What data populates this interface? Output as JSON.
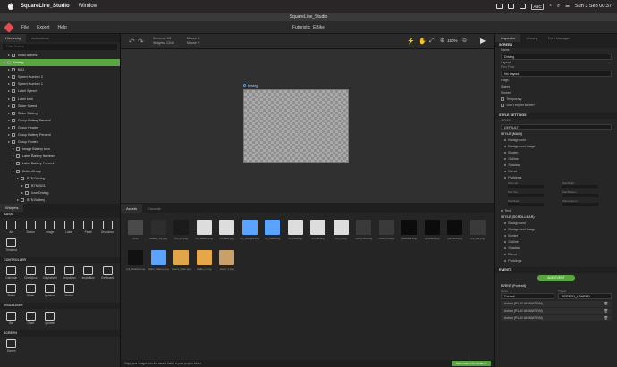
{
  "menubar": {
    "app_name": "SquareLine_Studio",
    "window_menu": "Window",
    "abc": "ABC",
    "datetime": "Sun 3 Sep  00:37"
  },
  "window": {
    "title": "SquareLine_Studio"
  },
  "appbar": {
    "menus": [
      "File",
      "Export",
      "Help"
    ],
    "project_title": "Futuristic_EBike"
  },
  "hierarchy": {
    "tabs": [
      "Hierarchy",
      "Animations"
    ],
    "search_placeholder": "Filter Screen",
    "rows": [
      {
        "label": "Initial actions",
        "indent": 1,
        "selected": false
      },
      {
        "label": "Driving",
        "indent": 0,
        "selected": true
      },
      {
        "label": "BG1",
        "indent": 1,
        "selected": false
      },
      {
        "label": "Speed Number 2",
        "indent": 1,
        "selected": false
      },
      {
        "label": "Speed Number 1",
        "indent": 1,
        "selected": false
      },
      {
        "label": "Label Speed",
        "indent": 1,
        "selected": false
      },
      {
        "label": "Label kmh",
        "indent": 1,
        "selected": false
      },
      {
        "label": "Slider Speed",
        "indent": 1,
        "selected": false
      },
      {
        "label": "Slider Battery",
        "indent": 1,
        "selected": false
      },
      {
        "label": "Group Battery Percent",
        "indent": 1,
        "selected": false
      },
      {
        "label": "Group Header",
        "indent": 1,
        "selected": false
      },
      {
        "label": "Group Battery Percent",
        "indent": 1,
        "selected": false
      },
      {
        "label": "Group Footer",
        "indent": 1,
        "selected": false
      },
      {
        "label": "Image Battery icon",
        "indent": 2,
        "selected": false
      },
      {
        "label": "Label Battery Number",
        "indent": 2,
        "selected": false
      },
      {
        "label": "Label Battery Percent",
        "indent": 2,
        "selected": false
      },
      {
        "label": "ButtonGroup",
        "indent": 2,
        "selected": false
      },
      {
        "label": "BTN Driving",
        "indent": 3,
        "selected": false
      },
      {
        "label": "BTN BG1",
        "indent": 4,
        "selected": false
      },
      {
        "label": "Icon Driving",
        "indent": 4,
        "selected": false
      },
      {
        "label": "BTN Battery",
        "indent": 3,
        "selected": false
      },
      {
        "label": "BTN BG2",
        "indent": 4,
        "selected": false
      },
      {
        "label": "Icon Battery",
        "indent": 4,
        "selected": false
      }
    ]
  },
  "widgets": {
    "tab": "Widgets",
    "sections": [
      {
        "title": "BASIC",
        "items": [
          "Arc",
          "Button",
          "Image",
          "Label",
          "Panel",
          "Dropdown",
          "Textarea"
        ]
      },
      {
        "title": "CONTROLLER",
        "items": [
          "Calendar",
          "Checkbox",
          "Colorwheel",
          "Dropdown",
          "Imgbutton",
          "Keyboard",
          "Roller",
          "Slider",
          "Spinbox",
          "Switch"
        ]
      },
      {
        "title": "VISUALISER",
        "items": [
          "Bar",
          "Chart",
          "Spinner"
        ]
      },
      {
        "title": "SCREEN",
        "items": [
          "Screen"
        ]
      }
    ]
  },
  "toolbar": {
    "screen_label": "Screens:",
    "screen_value": "1/5",
    "widgets_label": "Widgets:",
    "widgets_value": "13/46",
    "mouse_x": "Mouse X:",
    "mouse_y": "Mouse Y:",
    "zoom": "150%"
  },
  "canvas": {
    "screen_name": "Driving"
  },
  "assets": {
    "tabs": [
      "Assets",
      "Console"
    ],
    "items": [
      {
        "name": "fonts",
        "color": "#4a4a4a"
      },
      {
        "name": "battery_bg.png",
        "color": "#2e2e2e"
      },
      {
        "name": "btn_bg.png",
        "color": "#1b1b1b"
      },
      {
        "name": "icn_battery.png",
        "color": "#dddddd"
      },
      {
        "name": "icn_bike.png",
        "color": "#dddddd"
      },
      {
        "name": "icn_charge1.png",
        "color": "#5aa3ff"
      },
      {
        "name": "icn_flash.png",
        "color": "#5aa3ff"
      },
      {
        "name": "icn_lock.png",
        "color": "#dddddd"
      },
      {
        "name": "icn_ok.png",
        "color": "#dddddd"
      },
      {
        "name": "icn_x.png",
        "color": "#dddddd"
      },
      {
        "name": "menu_line.png",
        "color": "#3a3a3a"
      },
      {
        "name": "menu_ov.png",
        "color": "#3a3a3a"
      },
      {
        "name": "particle1.png",
        "color": "#0c0c0c"
      },
      {
        "name": "particle2.png",
        "color": "#0c0c0c"
      },
      {
        "name": "particle3.png",
        "color": "#0c0c0c"
      },
      {
        "name": "pnl_line.png",
        "color": "#3a3a3a"
      },
      {
        "name": "pnl_shadow.png",
        "color": "#111111"
      },
      {
        "name": "slider_battery.png",
        "color": "#5aa3ff"
      },
      {
        "name": "speed_slider.png",
        "color": "#e0a64a"
      },
      {
        "name": "wallet_1.png",
        "color": "#e8a64a"
      },
      {
        "name": "wood_1.png",
        "color": "#c9a06a"
      }
    ],
    "footer_text": "Copy your images into the assets folder in your project folder",
    "add_button": "ADD FILE INTO ASSETS"
  },
  "inspector": {
    "tabs": [
      "Inspector",
      "Library",
      "Font Manager"
    ],
    "screen_head": "SCREEN",
    "name_label": "Name",
    "name_value": "Driving",
    "layout_label": "Layout",
    "flex_label": "Flex Flow",
    "flex_value": "No Layout",
    "rows1": [
      "Flags",
      "States",
      "Screen"
    ],
    "check1": "Temporary",
    "check2": "Don't export screen",
    "style_head": "STYLE SETTINGS",
    "state_label": "STATE",
    "state_value": "DEFAULT",
    "main_head": "STYLE (MAIN)",
    "main_items": [
      "Background",
      "Background Image",
      "Border",
      "Outline",
      "Shadow",
      "Blend",
      "Paddings"
    ],
    "pad_labels": [
      "Pad Left",
      "Pad Right",
      "Pad Top",
      "Pad Bottom",
      "Pad Row",
      "Pad Column"
    ],
    "text_item": "Text",
    "scroll_head": "STYLE (SCROLLBAR)",
    "scroll_items": [
      "Background",
      "Background Image",
      "Border",
      "Outline",
      "Shadow",
      "Blend",
      "Paddings"
    ],
    "events_head": "EVENTS",
    "add_event": "ADD EVENT",
    "event_title": "EVENT (Portrait)",
    "event_name_label": "Name",
    "event_name": "Portrait",
    "trigger_label": "Trigger",
    "trigger_value": "SCREEN_LOADED",
    "actions": [
      "Action (PLAY ANIMATION)",
      "Action (PLAY ANIMATION)",
      "Action (PLAY ANIMATION)"
    ]
  }
}
